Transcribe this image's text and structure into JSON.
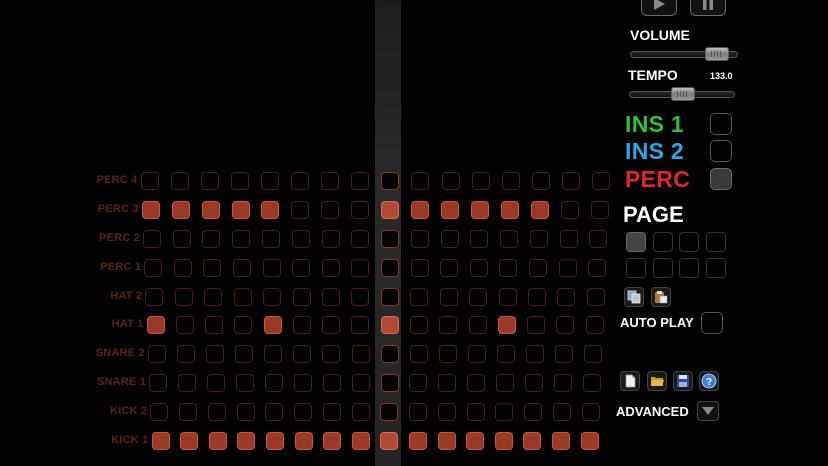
{
  "sequencer": {
    "playhead_step": 8,
    "rows": [
      {
        "label": "PERC 4",
        "steps": [
          0,
          0,
          0,
          0,
          0,
          0,
          0,
          0,
          0,
          0,
          0,
          0,
          0,
          0,
          0,
          0
        ]
      },
      {
        "label": "PERC 3",
        "steps": [
          1,
          1,
          1,
          1,
          1,
          0,
          0,
          0,
          1,
          1,
          1,
          1,
          1,
          1,
          0,
          0
        ]
      },
      {
        "label": "PERC 2",
        "steps": [
          0,
          0,
          0,
          0,
          0,
          0,
          0,
          0,
          0,
          0,
          0,
          0,
          0,
          0,
          0,
          0
        ]
      },
      {
        "label": "PERC 1",
        "steps": [
          0,
          0,
          0,
          0,
          0,
          0,
          0,
          0,
          0,
          0,
          0,
          0,
          0,
          0,
          0,
          0
        ]
      },
      {
        "label": "HAT 2",
        "steps": [
          0,
          0,
          0,
          0,
          0,
          0,
          0,
          0,
          0,
          0,
          0,
          0,
          0,
          0,
          0,
          0
        ]
      },
      {
        "label": "HAT 1",
        "steps": [
          1,
          0,
          0,
          0,
          1,
          0,
          0,
          0,
          1,
          0,
          0,
          0,
          1,
          0,
          0,
          0
        ]
      },
      {
        "label": "SNARE 2",
        "steps": [
          0,
          0,
          0,
          0,
          0,
          0,
          0,
          0,
          0,
          0,
          0,
          0,
          0,
          0,
          0,
          0
        ]
      },
      {
        "label": "SNARE 1",
        "steps": [
          0,
          0,
          0,
          0,
          0,
          0,
          0,
          0,
          0,
          0,
          0,
          0,
          0,
          0,
          0,
          0
        ]
      },
      {
        "label": "KICK 2",
        "steps": [
          0,
          0,
          0,
          0,
          0,
          0,
          0,
          0,
          0,
          0,
          0,
          0,
          0,
          0,
          0,
          0
        ]
      },
      {
        "label": "KICK 1",
        "steps": [
          1,
          1,
          1,
          1,
          1,
          1,
          1,
          1,
          1,
          1,
          1,
          1,
          1,
          1,
          1,
          1
        ]
      }
    ]
  },
  "controls": {
    "play_icon": "play-icon",
    "pause_icon": "pause-icon",
    "volume_label": "VOLUME",
    "volume_level": 0.88,
    "tempo_label": "TEMPO",
    "tempo_value": "133.0",
    "tempo_level": 0.5
  },
  "instruments": [
    {
      "label": "INS 1",
      "color": "#2fbf3a",
      "checked": false
    },
    {
      "label": "INS 2",
      "color": "#2aa9e6",
      "checked": false
    },
    {
      "label": "PERC",
      "color": "#e0282a",
      "checked": true
    }
  ],
  "page": {
    "title": "PAGE",
    "active_index": 0,
    "count": 8,
    "copy_icon": "copy-icon",
    "paste_icon": "paste-icon"
  },
  "auto_play": {
    "label": "AUTO PLAY",
    "checked": false
  },
  "file_buttons": [
    {
      "name": "new-file-icon"
    },
    {
      "name": "open-folder-icon"
    },
    {
      "name": "save-icon"
    },
    {
      "name": "help-icon"
    }
  ],
  "advanced": {
    "label": "ADVANCED",
    "icon": "triangle-down-icon"
  }
}
